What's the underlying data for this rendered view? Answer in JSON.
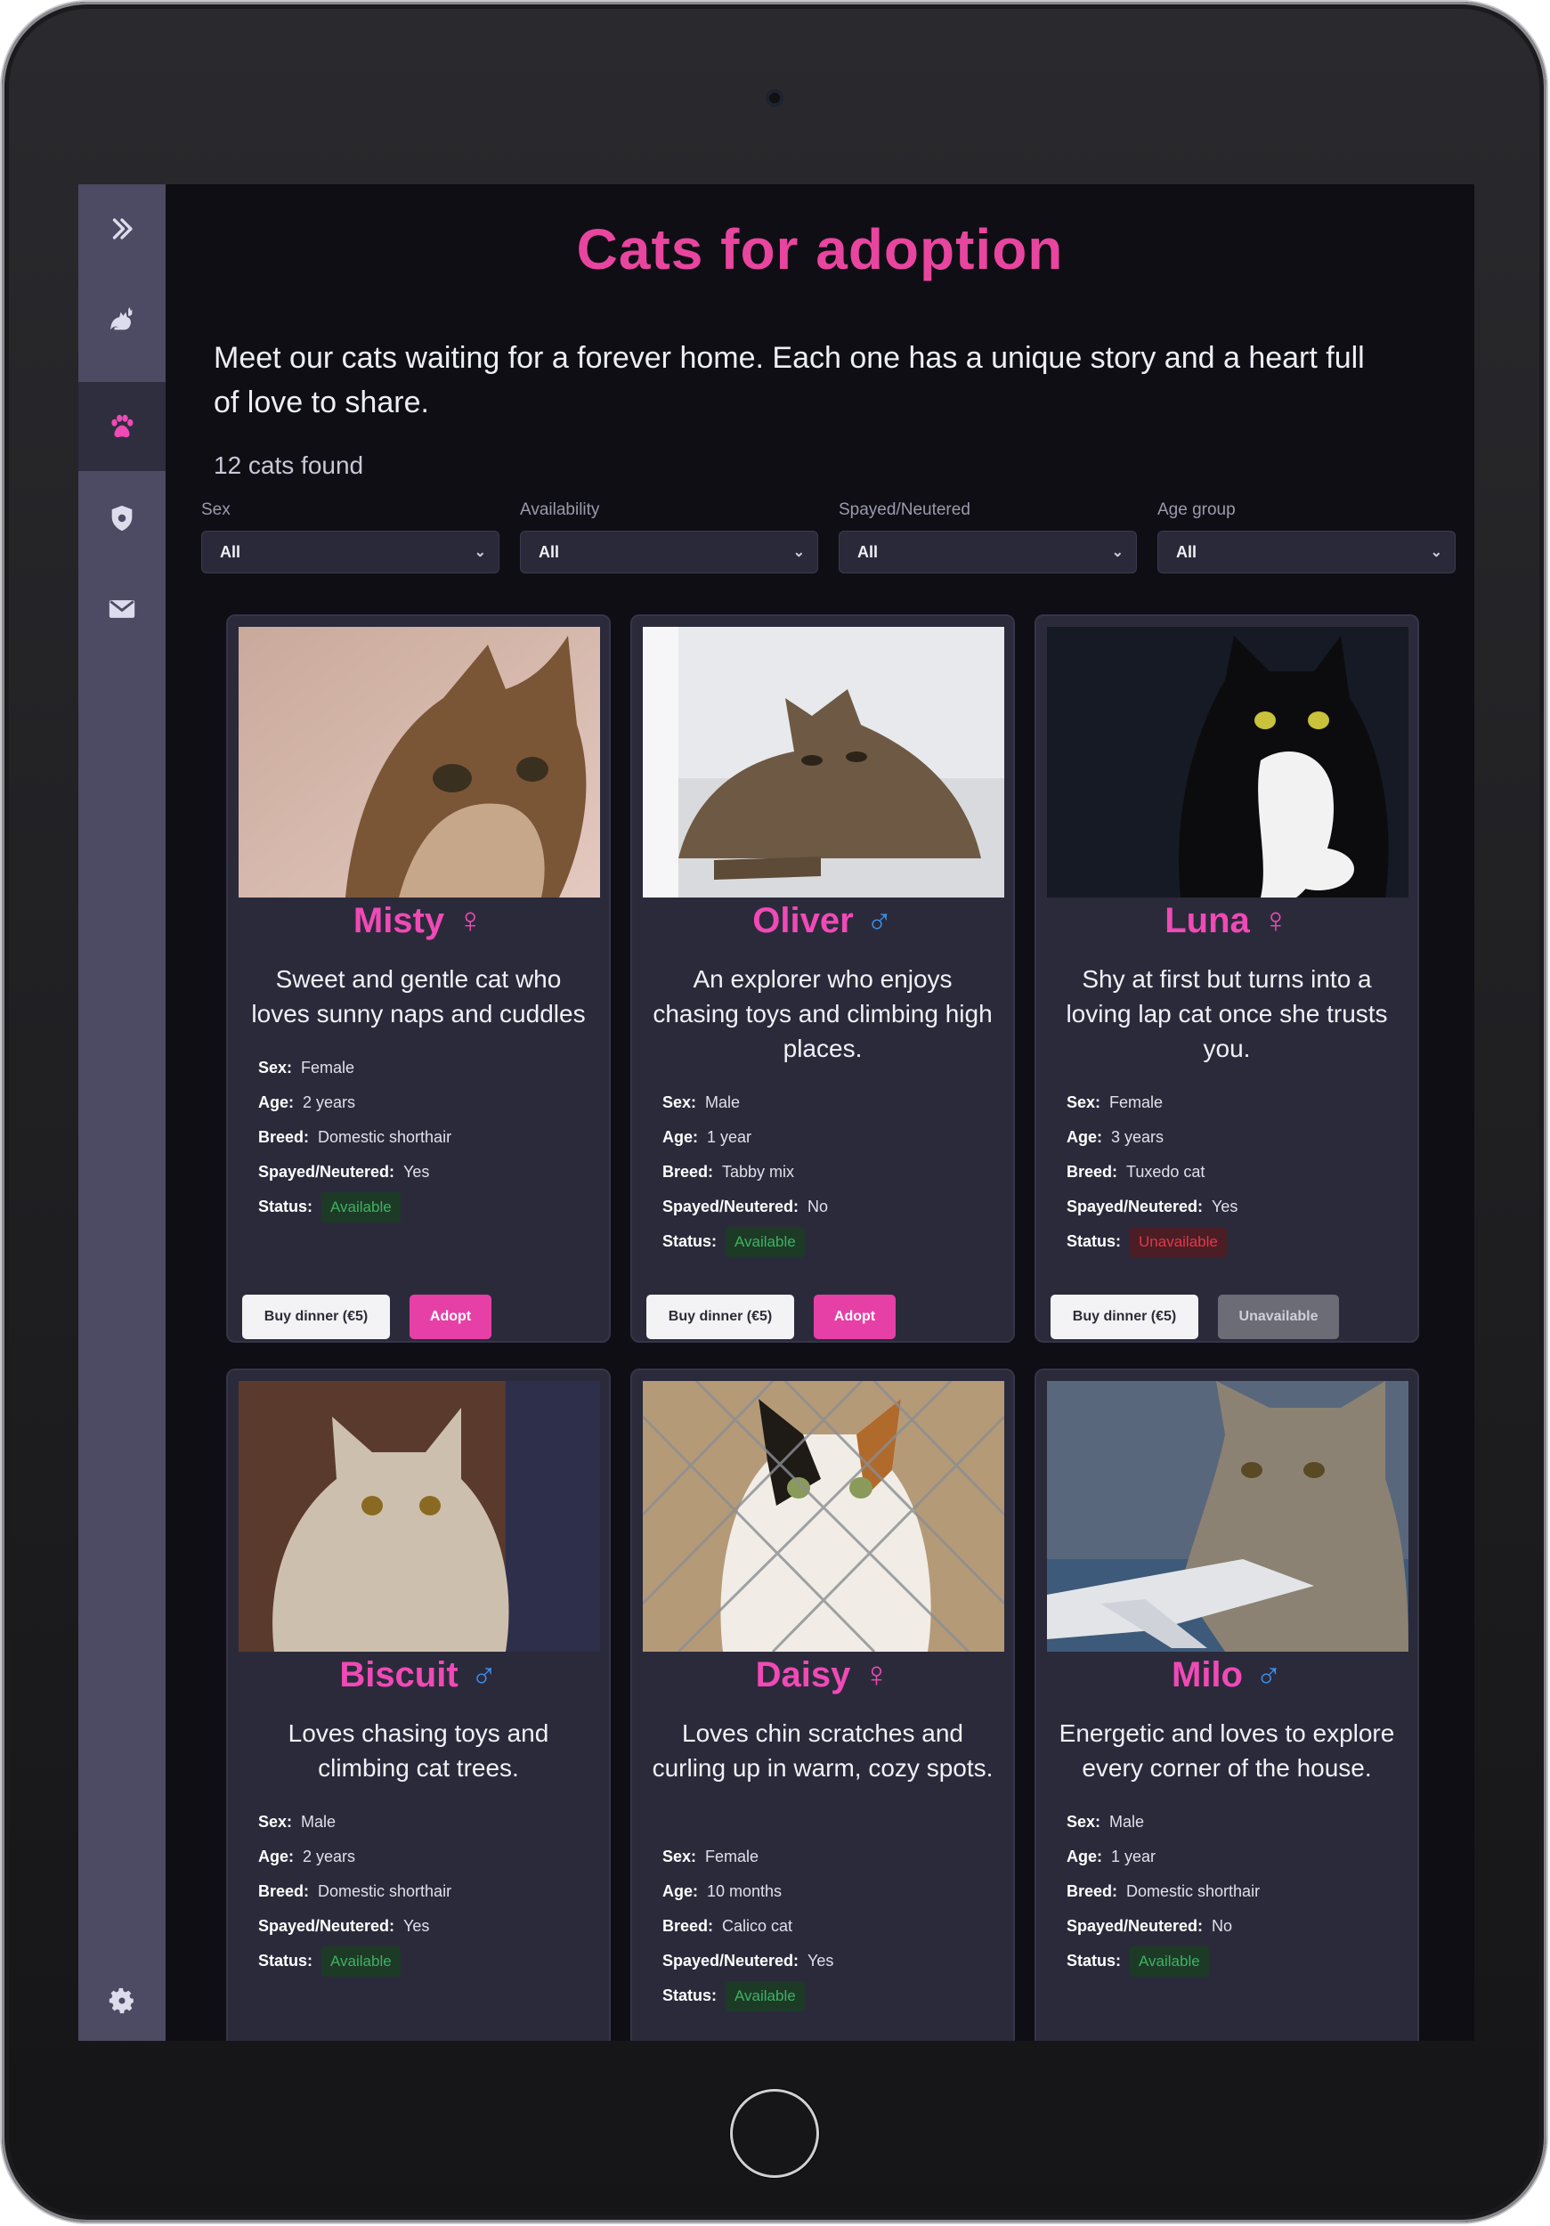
{
  "page": {
    "title": "Cats for adoption",
    "intro": "Meet our cats waiting for a forever home. Each one has a unique story and a heart full of love to share.",
    "count": "12 cats found"
  },
  "sidebar": {
    "items": [
      {
        "name": "expand",
        "icon": "double-chevron-right-icon"
      },
      {
        "name": "cats",
        "icon": "cat-icon"
      },
      {
        "name": "paw",
        "icon": "paw-icon",
        "active": true
      },
      {
        "name": "shield",
        "icon": "shield-icon"
      },
      {
        "name": "mail",
        "icon": "mail-icon"
      },
      {
        "name": "settings",
        "icon": "gear-icon"
      }
    ]
  },
  "filters": [
    {
      "label": "Sex",
      "value": "All"
    },
    {
      "label": "Availability",
      "value": "All"
    },
    {
      "label": "Spayed/Neutered",
      "value": "All"
    },
    {
      "label": "Age group",
      "value": "All"
    }
  ],
  "labels": {
    "sex": "Sex:",
    "age": "Age:",
    "breed": "Breed:",
    "spayed": "Spayed/Neutered:",
    "status": "Status:"
  },
  "buttons": {
    "dinner": "Buy dinner (€5)",
    "adopt": "Adopt",
    "unavailable": "Unavailable"
  },
  "cats": [
    {
      "name": "Misty",
      "sex_symbol": "♀",
      "desc": "Sweet and gentle cat who loves sunny naps and cuddles",
      "sex": "Female",
      "age": "2 years",
      "breed": "Domestic shorthair",
      "spayed": "Yes",
      "status": "Available",
      "photo": "tabby-cat-photo"
    },
    {
      "name": "Oliver",
      "sex_symbol": "♂",
      "desc": "An explorer who enjoys chasing toys and climbing high places.",
      "sex": "Male",
      "age": "1 year",
      "breed": "Tabby mix",
      "spayed": "No",
      "status": "Available",
      "photo": "lying-tabby-photo"
    },
    {
      "name": "Luna",
      "sex_symbol": "♀",
      "desc": "Shy at first but turns into a loving lap cat once she trusts you.",
      "sex": "Female",
      "age": "3 years",
      "breed": "Tuxedo cat",
      "spayed": "Yes",
      "status": "Unavailable",
      "photo": "tuxedo-cat-photo"
    },
    {
      "name": "Biscuit",
      "sex_symbol": "♂",
      "desc": "Loves chasing toys and climbing cat trees.",
      "sex": "Male",
      "age": "2 years",
      "breed": "Domestic shorthair",
      "spayed": "Yes",
      "status": "Available",
      "photo": "fluffy-cream-cat-photo"
    },
    {
      "name": "Daisy",
      "sex_symbol": "♀",
      "desc": "Loves chin scratches and curling up in warm, cozy spots.",
      "sex": "Female",
      "age": "10 months",
      "breed": "Calico cat",
      "spayed": "Yes",
      "status": "Available",
      "photo": "calico-cat-photo"
    },
    {
      "name": "Milo",
      "sex_symbol": "♂",
      "desc": "Energetic and loves to explore every corner of the house.",
      "sex": "Male",
      "age": "1 year",
      "breed": "Domestic shorthair",
      "spayed": "No",
      "status": "Available",
      "photo": "grey-tabby-photo"
    }
  ],
  "colors": {
    "accent": "#e8459f",
    "male": "#3b8fe8",
    "available": "#3fb163",
    "unavailable": "#e0394c",
    "sidebar": "#4c4b63",
    "background": "#0f0e14",
    "card": "#2b2a3b"
  }
}
